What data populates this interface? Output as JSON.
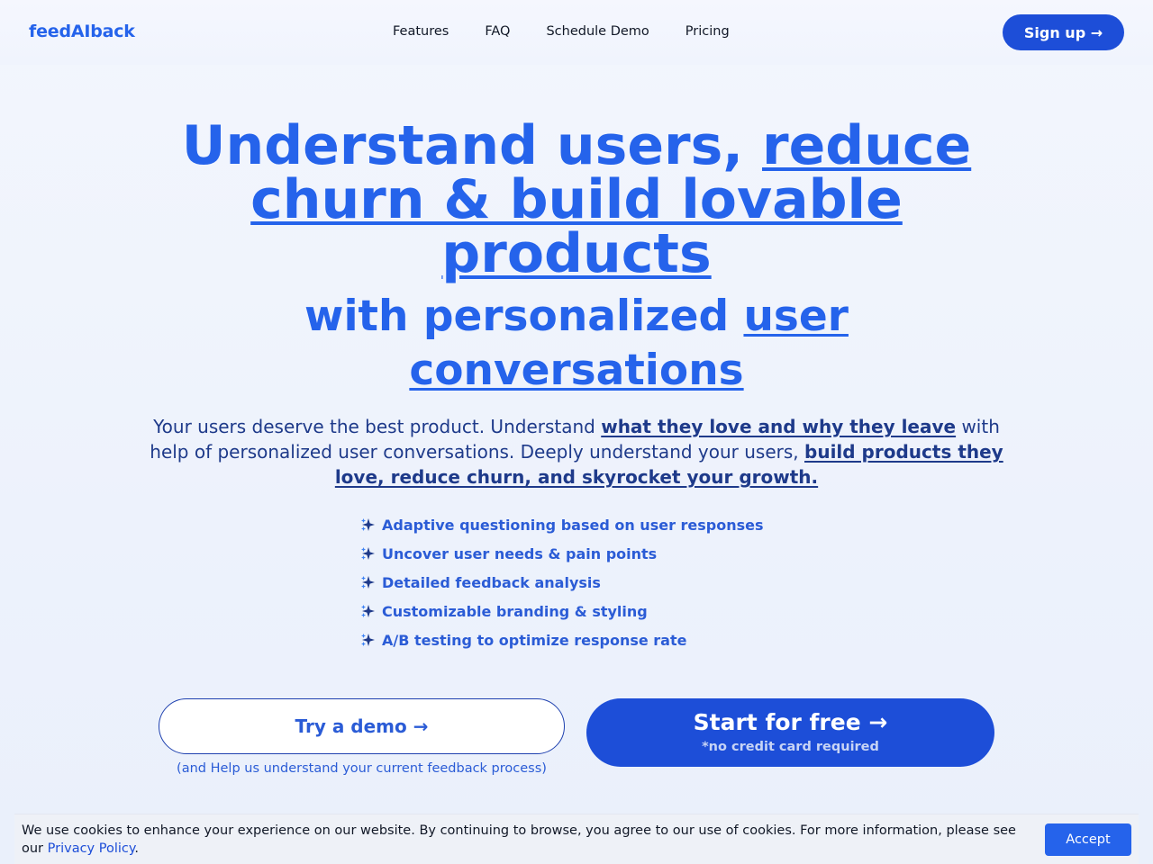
{
  "header": {
    "logo": "feedAIback",
    "nav": [
      "Features",
      "FAQ",
      "Schedule Demo",
      "Pricing"
    ],
    "signup_label": "Sign up →"
  },
  "hero": {
    "title_plain": "Understand users, ",
    "title_underlined": "reduce churn & build lovable products",
    "subtitle_plain": "with personalized ",
    "subtitle_underlined": "user conversations",
    "desc_1": "Your users deserve the best product. Understand ",
    "desc_bold_1": "what they love and why they leave",
    "desc_2": " with help of personalized user conversations. Deeply understand your users, ",
    "desc_bold_2": "build products they love, reduce churn, and skyrocket your growth."
  },
  "features": [
    "Adaptive questioning based on user responses",
    "Uncover user needs & pain points",
    "Detailed feedback analysis",
    "Customizable branding & styling",
    "A/B testing to optimize response rate"
  ],
  "cta": {
    "demo_label": "Try a demo →",
    "demo_note": "(and Help us understand your current feedback process)",
    "start_label": "Start for free →",
    "start_note": "*no credit card required"
  },
  "cookie": {
    "text": "We use cookies to enhance your experience on our website. By continuing to browse, you agree to our use of cookies. For more information, please see our ",
    "link": "Privacy Policy",
    "end": ".",
    "accept_label": "Accept"
  },
  "colors": {
    "brand": "#2563eb",
    "button": "#1d4ed8",
    "text_dark": "#1e3a8a",
    "spark_navy": "#1e3a8a",
    "spark_blue": "#3b82f6"
  }
}
